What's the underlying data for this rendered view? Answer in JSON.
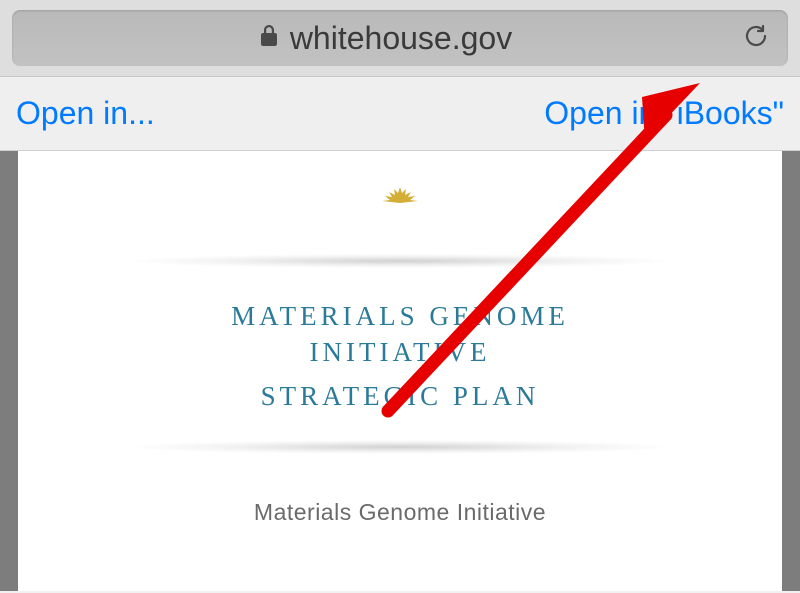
{
  "navbar": {
    "url": "whitehouse.gov"
  },
  "actions": {
    "open_in": "Open in...",
    "open_in_ibooks": "Open in \"iBooks\""
  },
  "document": {
    "title_line1": "MATERIALS GENOME",
    "title_line2": "INITIATIVE",
    "title_line3": "STRATEGIC PLAN",
    "subtitle": "Materials Genome Initiative"
  }
}
